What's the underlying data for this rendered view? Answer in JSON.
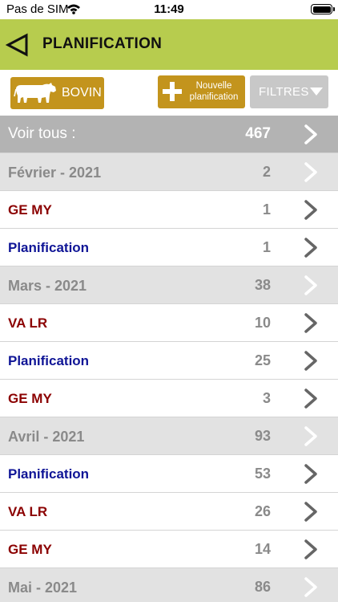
{
  "status_bar": {
    "carrier": "Pas de SIM",
    "time": "11:49"
  },
  "nav": {
    "title": "PLANIFICATION",
    "back_icon": "back-triangle-icon"
  },
  "toolbar": {
    "species_label": "BOVIN",
    "species_icon": "cow-icon",
    "new_label_line1": "Nouvelle",
    "new_label_line2": "planification",
    "filters_label": "FILTRES"
  },
  "colors": {
    "nav_green": "#b7cc4e",
    "button_gold": "#c3941d",
    "filters_grey": "#c8c8c8",
    "label_red": "#8b0000",
    "label_blue": "#0f1596"
  },
  "list": {
    "rows": [
      {
        "type": "all",
        "label": "Voir tous :",
        "count": "467"
      },
      {
        "type": "month",
        "label": "Février - 2021",
        "count": "2"
      },
      {
        "type": "red",
        "label": "GE MY",
        "count": "1"
      },
      {
        "type": "blue",
        "label": "Planification",
        "count": "1"
      },
      {
        "type": "month",
        "label": "Mars - 2021",
        "count": "38"
      },
      {
        "type": "red",
        "label": "VA LR",
        "count": "10"
      },
      {
        "type": "blue",
        "label": "Planification",
        "count": "25"
      },
      {
        "type": "red",
        "label": "GE MY",
        "count": "3"
      },
      {
        "type": "month",
        "label": "Avril - 2021",
        "count": "93"
      },
      {
        "type": "blue",
        "label": "Planification",
        "count": "53"
      },
      {
        "type": "red",
        "label": "VA LR",
        "count": "26"
      },
      {
        "type": "red",
        "label": "GE MY",
        "count": "14"
      },
      {
        "type": "month",
        "label": "Mai - 2021",
        "count": "86"
      }
    ]
  }
}
